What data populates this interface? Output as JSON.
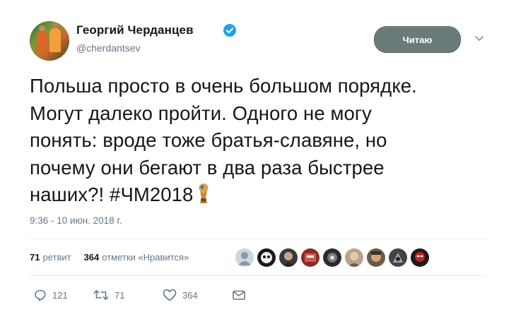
{
  "author": {
    "name": "Георгий Черданцев",
    "handle": "@cherdantsev",
    "verified": true
  },
  "header": {
    "follow_label": "Читаю"
  },
  "tweet": {
    "text": "Польша просто в очень большом порядке.\nМогут далеко пройти. Одного не могу\nпонять: вроде тоже братья-славяне, но\nпочему они бегают в два раза быстрее\nнаших?!",
    "hashtag": "#ЧМ2018",
    "timestamp": "9:36 - 10 июн. 2018 г."
  },
  "stats": {
    "retweets_count": "71",
    "retweets_label": "ретвит",
    "likes_count": "364",
    "likes_label": "отметки «Нравится»"
  },
  "actions": {
    "reply_count": "121",
    "retweet_count": "71",
    "like_count": "364"
  },
  "colors": {
    "verified": "#1da1f2",
    "follow_button": "#6b7b7a",
    "secondary_text": "#657786"
  }
}
